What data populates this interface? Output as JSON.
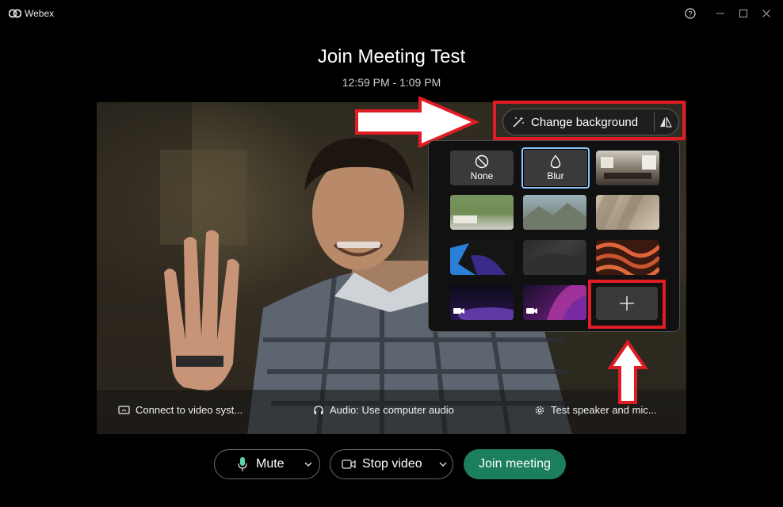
{
  "window": {
    "app_name": "Webex",
    "controls": [
      "help-icon",
      "minimize-icon",
      "maximize-icon",
      "close-icon"
    ]
  },
  "meeting": {
    "title": "Join Meeting Test",
    "time": "12:59 PM - 1:09 PM"
  },
  "background_menu": {
    "change_background_label": "Change background",
    "options": [
      {
        "label": "None",
        "icon": "ban-icon"
      },
      {
        "label": "Blur",
        "icon": "drop-icon",
        "selected": true
      }
    ]
  },
  "video_bar": {
    "connect_label": "Connect to video syst...",
    "audio_label": "Audio: Use computer audio",
    "test_label": "Test speaker and mic..."
  },
  "controls": {
    "mute_label": "Mute",
    "stop_video_label": "Stop video",
    "join_label": "Join meeting"
  },
  "colors": {
    "join_button": "#1b7f5c",
    "annotation_red": "#e01d24",
    "selected_outline": "#8ec5ff"
  }
}
